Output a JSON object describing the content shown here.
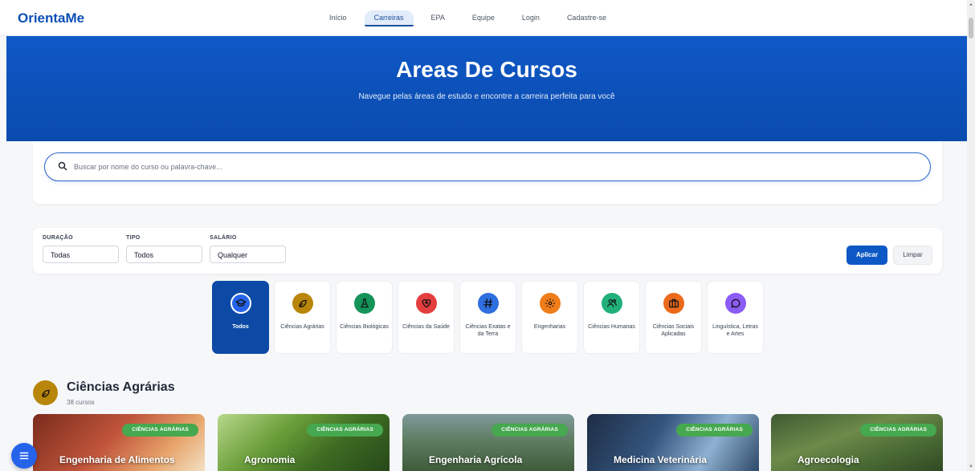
{
  "brand": "OrientaMe",
  "nav": [
    {
      "label": "Início",
      "active": false
    },
    {
      "label": "Carreiras",
      "active": true
    },
    {
      "label": "EPA",
      "active": false
    },
    {
      "label": "Equipe",
      "active": false
    },
    {
      "label": "Login",
      "active": false
    },
    {
      "label": "Cadastre-se",
      "active": false
    }
  ],
  "hero": {
    "title": "Areas De Cursos",
    "subtitle": "Navegue pelas áreas de estudo e encontre a carreira perfeita para você"
  },
  "search": {
    "placeholder": "Buscar por nome do curso ou palavra-chave...",
    "value": ""
  },
  "filters": {
    "duration": {
      "label": "DURAÇÃO",
      "value": "Todas"
    },
    "type": {
      "label": "TIPO",
      "value": "Todos"
    },
    "salary": {
      "label": "SALÁRIO",
      "value": "Qualquer"
    },
    "apply_label": "Aplicar",
    "clear_label": "Limpar"
  },
  "categories": [
    {
      "label": "Todos",
      "icon": "graduation-icon",
      "color": "#2563eb",
      "active": true
    },
    {
      "label": "Ciências Agrárias",
      "icon": "leaf-icon",
      "color": "#b8860b",
      "active": false
    },
    {
      "label": "Ciências Biológicas",
      "icon": "flask-icon",
      "color": "#15945a",
      "active": false
    },
    {
      "label": "Ciências da Saúde",
      "icon": "heart-icon",
      "color": "#e53e3e",
      "active": false
    },
    {
      "label": "Ciências Exatas e da Terra",
      "icon": "hash-icon",
      "color": "#2f6fe0",
      "active": false
    },
    {
      "label": "Engenharias",
      "icon": "gear-icon",
      "color": "#ef7d1a",
      "active": false
    },
    {
      "label": "Ciências Humanas",
      "icon": "users-icon",
      "color": "#22b07a",
      "active": false
    },
    {
      "label": "Ciências Sociais Aplicadas",
      "icon": "briefcase-icon",
      "color": "#ec6a1c",
      "active": false
    },
    {
      "label": "Linguística, Letras e Artes",
      "icon": "speech-icon",
      "color": "#8b5cf6",
      "active": false
    }
  ],
  "section": {
    "title": "Ciências Agrárias",
    "count": "38 cursos",
    "icon": "leaf-icon",
    "color": "#b8860b"
  },
  "courses": [
    {
      "title": "Engenharia de Alimentos",
      "badge": "CIÊNCIAS AGRÁRIAS"
    },
    {
      "title": "Agronomia",
      "badge": "CIÊNCIAS AGRÁRIAS"
    },
    {
      "title": "Engenharia Agrícola",
      "badge": "CIÊNCIAS AGRÁRIAS"
    },
    {
      "title": "Medicina Veterinária",
      "badge": "CIÊNCIAS AGRÁRIAS"
    },
    {
      "title": "Agroecologia",
      "badge": "CIÊNCIAS AGRÁRIAS"
    }
  ]
}
